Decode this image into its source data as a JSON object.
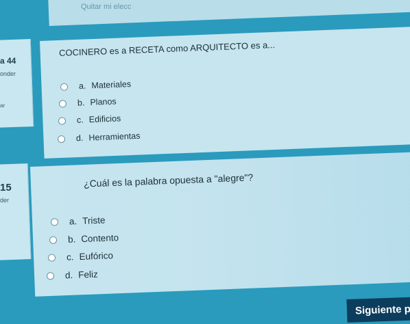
{
  "top": {
    "clear_label": "Quitar mi elecc"
  },
  "questions": [
    {
      "number": "a 44",
      "info": "onder",
      "info2": "ar",
      "text": "COCINERO es a RECETA como ARQUITECTO es a...",
      "options": [
        {
          "letter": "a.",
          "label": "Materiales"
        },
        {
          "letter": "b.",
          "label": "Planos"
        },
        {
          "letter": "c.",
          "label": "Edificios"
        },
        {
          "letter": "d.",
          "label": "Herramientas"
        }
      ]
    },
    {
      "number": "15",
      "info": "der",
      "text": "¿Cuál es la palabra opuesta a \"alegre\"?",
      "options": [
        {
          "letter": "a.",
          "label": "Triste"
        },
        {
          "letter": "b.",
          "label": "Contento"
        },
        {
          "letter": "c.",
          "label": "Eufórico"
        },
        {
          "letter": "d.",
          "label": "Feliz"
        }
      ]
    }
  ],
  "footer": {
    "next_label": "Siguiente p"
  },
  "colors": {
    "background": "#2a9bbd",
    "card": "#c7e5ef",
    "button": "#0d3d5c"
  }
}
